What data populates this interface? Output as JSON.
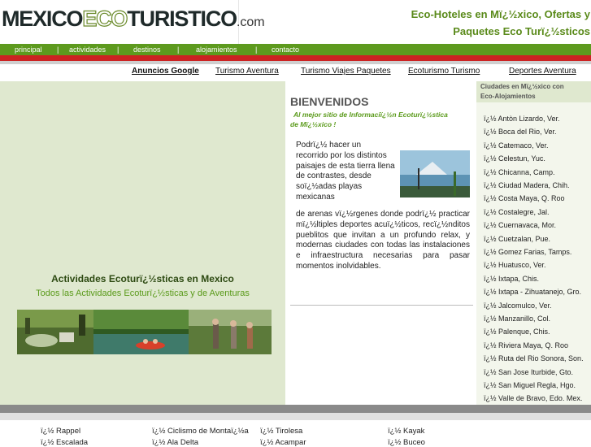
{
  "header": {
    "logo": {
      "part1": "MEXICO",
      "part2": "ECO",
      "part3": "TURISTICO",
      "part4": ".com"
    },
    "tagline_line1": "Eco-Hoteles en Mï¿½xico, Ofertas y",
    "tagline_line2": "Paquetes Eco Turï¿½sticos"
  },
  "nav": {
    "items": [
      "principal",
      "actividades",
      "destinos",
      "alojamientos",
      "contacto"
    ],
    "separator": "|"
  },
  "links_row": {
    "ads_label": "Anuncios Google",
    "links": [
      "Turismo Aventura",
      "Turismo Viajes Paquetes",
      "Ecoturismo Turismo",
      "Deportes Aventura"
    ]
  },
  "left_panel": {
    "title": "Actividades Ecoturï¿½sticas en Mexico",
    "subtitle": "Todos las Actividades Ecoturï¿½sticas y de Aventuras"
  },
  "welcome": {
    "title": "BIENVENIDOS",
    "sub_line1": "Al mejor sitio de Informaciï¿½n Ecoturï¿½stica",
    "sub_line2": "de Mï¿½xico !",
    "paragraph_top": "Podrï¿½ hacer un recorrido por los distintos paisajes de esta tierra llena de contrastes, desde soï¿½adas playas mexicanas",
    "paragraph_bottom": "de arenas vï¿½rgenes donde podrï¿½ practicar mï¿½ltiples deportes acuï¿½ticos, recï¿½nditos pueblitos que invitan a un profundo relax, y modernas ciudades con todas las instalaciones e infraestructura necesarias para pasar momentos inolvidables."
  },
  "cities": {
    "title_line1": "Ciudades en Mï¿½xico con",
    "title_line2": "Eco-Alojamientos",
    "items": [
      "ï¿½ Antòn Lizardo, Ver.",
      "ï¿½ Boca del Rio, Ver.",
      "ï¿½ Catemaco, Ver.",
      "ï¿½ Celestun, Yuc.",
      "ï¿½ Chicanna, Camp.",
      "ï¿½ Ciudad Madera, Chih.",
      "ï¿½ Costa Maya, Q. Roo",
      "ï¿½ Costalegre, Jal.",
      "ï¿½ Cuernavaca, Mor.",
      "ï¿½ Cuetzalan, Pue.",
      "ï¿½ Gomez Farias, Tamps.",
      "ï¿½ Huatusco, Ver.",
      "ï¿½ Ixtapa, Chis.",
      "ï¿½ Ixtapa - Zihuatanejo, Gro.",
      "ï¿½ Jalcomulco, Ver.",
      "ï¿½ Manzanillo, Col.",
      "ï¿½ Palenque, Chis.",
      "ï¿½ Riviera Maya, Q. Roo",
      "ï¿½ Ruta del Rio Sonora, Son.",
      "ï¿½ San Jose Iturbide, Gto.",
      "ï¿½ San Miguel Regla, Hgo.",
      "ï¿½ Valle de Bravo, Edo. Mex."
    ]
  },
  "activities": {
    "row1": [
      "ï¿½ Rappel",
      "ï¿½ Ciclismo de Montaï¿½a",
      "ï¿½ Tirolesa",
      "ï¿½ Kayak"
    ],
    "row2": [
      "ï¿½ Escalada",
      "ï¿½ Ala Delta",
      "ï¿½ Acampar",
      "ï¿½ Buceo"
    ]
  },
  "colors": {
    "brand_green": "#5d9a1e",
    "accent_red": "#cc2222",
    "panel_bg": "#dfe8cf"
  }
}
